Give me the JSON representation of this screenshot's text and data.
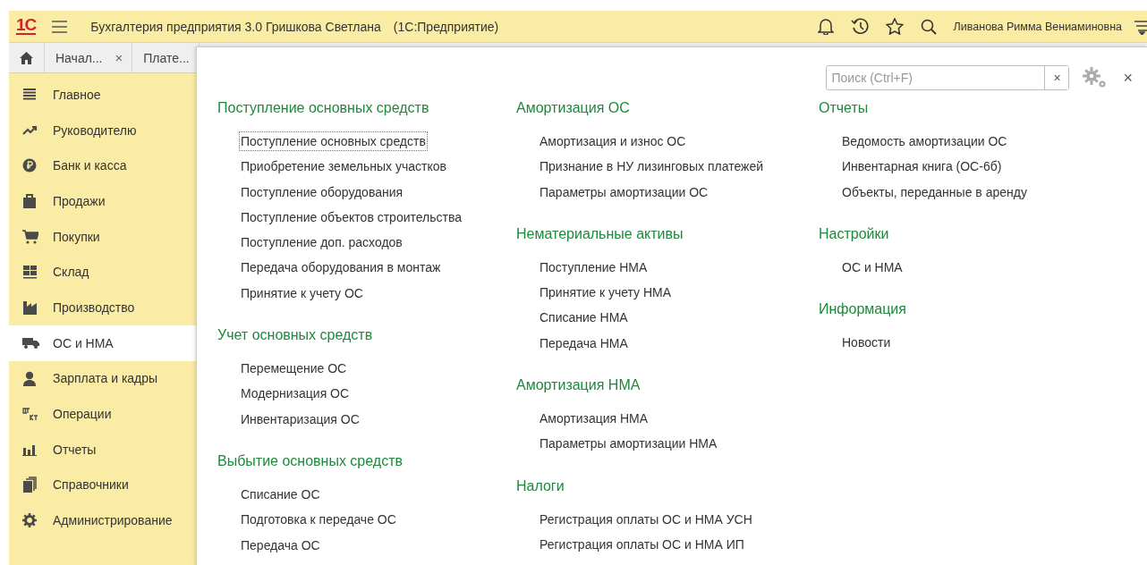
{
  "header": {
    "logo": "1С",
    "title": "Бухгалтерия предприятия 3.0 Гришкова Светлана",
    "app": "(1С:Предприятие)",
    "user": "Ливанова Римма Вениаминовна"
  },
  "tabs": [
    {
      "label": "Начал...",
      "close": "×",
      "selected": false
    },
    {
      "label": "Плате...",
      "selected": false
    }
  ],
  "sidebar": {
    "items": [
      {
        "label": "Главное",
        "selected": false
      },
      {
        "label": "Руководителю",
        "selected": false
      },
      {
        "label": "Банк и касса",
        "selected": false
      },
      {
        "label": "Продажи",
        "selected": false
      },
      {
        "label": "Покупки",
        "selected": false
      },
      {
        "label": "Склад",
        "selected": false
      },
      {
        "label": "Производство",
        "selected": false
      },
      {
        "label": "ОС и НМА",
        "selected": true
      },
      {
        "label": "Зарплата и кадры",
        "selected": false
      },
      {
        "label": "Операции",
        "selected": false
      },
      {
        "label": "Отчеты",
        "selected": false
      },
      {
        "label": "Справочники",
        "selected": false
      },
      {
        "label": "Администрирование",
        "selected": false
      }
    ]
  },
  "panel": {
    "search": {
      "placeholder": "Поиск (Ctrl+F)",
      "clear": "×"
    },
    "close": "×",
    "columns": [
      [
        {
          "heading": "Поступление основных средств",
          "links": [
            {
              "label": "Поступление основных средств",
              "selected": true
            },
            {
              "label": "Приобретение земельных участков",
              "selected": false
            },
            {
              "label": "Поступление оборудования",
              "selected": false
            },
            {
              "label": "Поступление объектов строительства",
              "selected": false
            },
            {
              "label": "Поступление доп. расходов",
              "selected": false
            },
            {
              "label": "Передача оборудования в монтаж",
              "selected": false
            },
            {
              "label": "Принятие к учету ОС",
              "selected": false
            }
          ]
        },
        {
          "heading": "Учет основных средств",
          "links": [
            {
              "label": "Перемещение ОС",
              "selected": false
            },
            {
              "label": "Модернизация ОС",
              "selected": false
            },
            {
              "label": "Инвентаризация ОС",
              "selected": false
            }
          ]
        },
        {
          "heading": "Выбытие основных средств",
          "links": [
            {
              "label": "Списание ОС",
              "selected": false
            },
            {
              "label": "Подготовка к передаче ОС",
              "selected": false
            },
            {
              "label": "Передача ОС",
              "selected": false
            }
          ]
        }
      ],
      [
        {
          "heading": "Амортизация ОС",
          "links": [
            {
              "label": "Амортизация и износ ОС",
              "selected": false
            },
            {
              "label": "Признание в НУ лизинговых платежей",
              "selected": false
            },
            {
              "label": "Параметры амортизации ОС",
              "selected": false
            }
          ]
        },
        {
          "heading": "Нематериальные активы",
          "links": [
            {
              "label": "Поступление НМА",
              "selected": false
            },
            {
              "label": "Принятие к учету НМА",
              "selected": false
            },
            {
              "label": "Списание НМА",
              "selected": false
            },
            {
              "label": "Передача НМА",
              "selected": false
            }
          ]
        },
        {
          "heading": "Амортизация НМА",
          "links": [
            {
              "label": "Амортизация НМА",
              "selected": false
            },
            {
              "label": "Параметры амортизации НМА",
              "selected": false
            }
          ]
        },
        {
          "heading": "Налоги",
          "links": [
            {
              "label": "Регистрация оплаты ОС и НМА УСН",
              "selected": false
            },
            {
              "label": "Регистрация оплаты ОС и НМА ИП",
              "selected": false
            }
          ]
        }
      ],
      [
        {
          "heading": "Отчеты",
          "links": [
            {
              "label": "Ведомость амортизации ОС",
              "selected": false
            },
            {
              "label": "Инвентарная книга (ОС-6б)",
              "selected": false
            },
            {
              "label": "Объекты, переданные в аренду",
              "selected": false
            }
          ]
        },
        {
          "heading": "Настройки",
          "links": [
            {
              "label": "ОС и НМА",
              "selected": false
            }
          ]
        },
        {
          "heading": "Информация",
          "links": [
            {
              "label": "Новости",
              "selected": false
            }
          ]
        }
      ]
    ]
  }
}
